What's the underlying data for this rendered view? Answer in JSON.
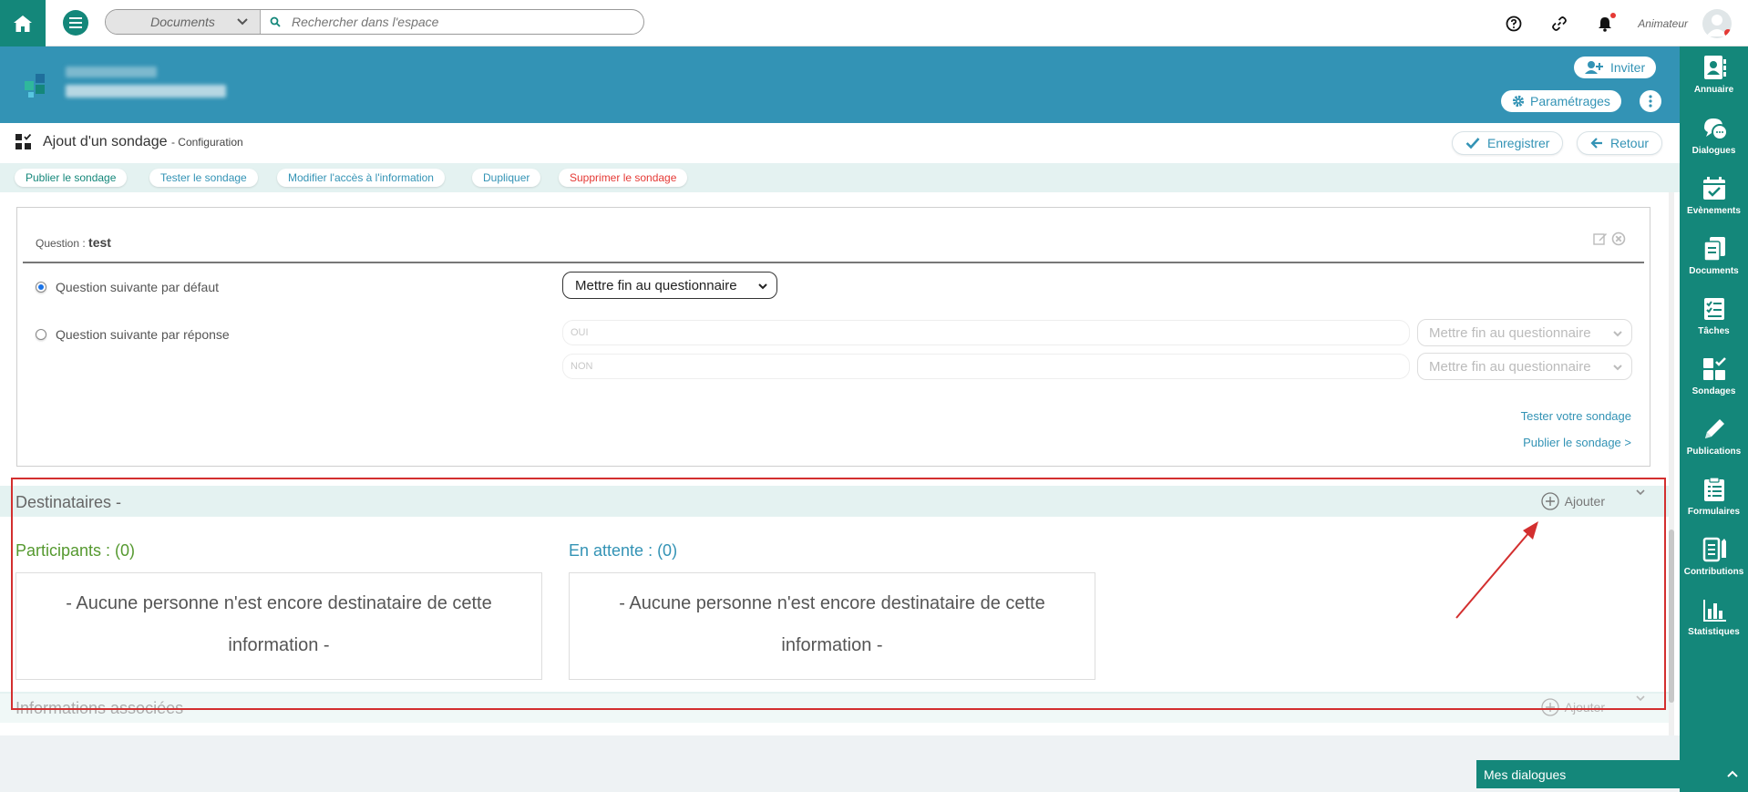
{
  "topbar": {
    "search_scope": "Documents",
    "search_placeholder": "Rechercher dans l'espace",
    "user_role": "Animateur"
  },
  "sidebar": {
    "items": [
      {
        "label": "Annuaire",
        "icon": "contact-book-icon"
      },
      {
        "label": "Dialogues",
        "icon": "chat-bubbles-icon"
      },
      {
        "label": "Evènements",
        "icon": "calendar-check-icon"
      },
      {
        "label": "Documents",
        "icon": "documents-icon"
      },
      {
        "label": "Tâches",
        "icon": "task-list-icon"
      },
      {
        "label": "Sondages",
        "icon": "poll-grid-icon"
      },
      {
        "label": "Publications",
        "icon": "pencil-icon"
      },
      {
        "label": "Formulaires",
        "icon": "form-clipboard-icon"
      },
      {
        "label": "Contributions",
        "icon": "contribution-icon"
      },
      {
        "label": "Statistiques",
        "icon": "bar-chart-icon"
      }
    ]
  },
  "space_header": {
    "invite_label": "Inviter",
    "settings_label": "Paramétrages"
  },
  "page": {
    "title": "Ajout d'un sondage",
    "subtitle": "- Configuration",
    "save_label": "Enregistrer",
    "back_label": "Retour"
  },
  "actions": {
    "publish": "Publier le sondage",
    "test": "Tester le sondage",
    "access": "Modifier l'accès à l'information",
    "duplicate": "Dupliquer",
    "delete": "Supprimer le sondage"
  },
  "question": {
    "label": "Question :",
    "name": "test",
    "default_next_label": "Question suivante par défaut",
    "default_next_value": "Mettre fin au questionnaire",
    "by_answer_label": "Question suivante par réponse",
    "answers": [
      {
        "text": "OUI",
        "next": "Mettre fin au questionnaire"
      },
      {
        "text": "NON",
        "next": "Mettre fin au questionnaire"
      }
    ],
    "test_link": "Tester votre sondage",
    "publish_link": "Publier le sondage >"
  },
  "recipients": {
    "title": "Destinataires -",
    "add_label": "Ajouter",
    "participants_title": "Participants : (0)",
    "pending_title": "En attente : (0)",
    "empty_line1": "- Aucune personne n'est encore destinataire de cette",
    "empty_line2": "information -"
  },
  "associated": {
    "title": "Informations associées",
    "add_label": "Ajouter"
  },
  "dialogs_bar": {
    "label": "Mes dialogues"
  },
  "colors": {
    "brand_green": "#14877a",
    "header_blue": "#3393b5",
    "band": "#e4f2f1",
    "danger": "#e53935",
    "annotation": "#d32f2f"
  }
}
